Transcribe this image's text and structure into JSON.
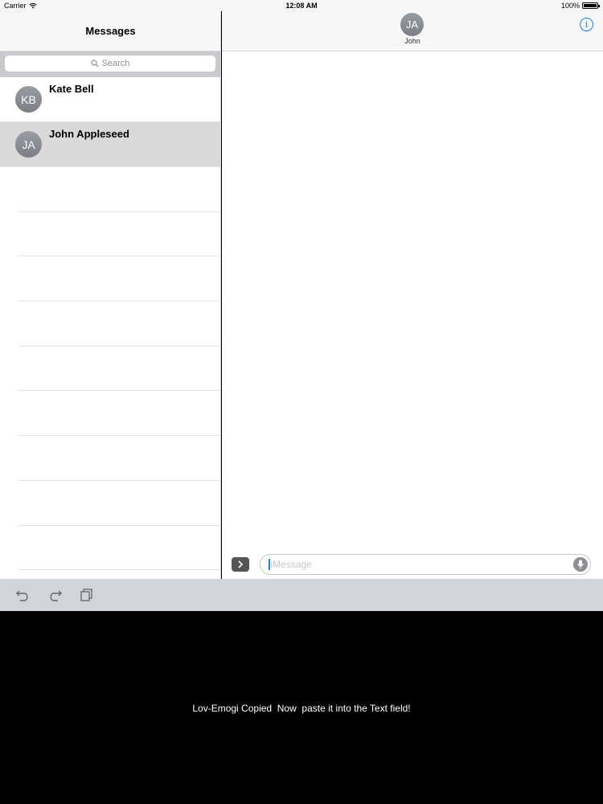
{
  "status_bar": {
    "carrier": "Carrier",
    "time": "12:08 AM",
    "battery": "100%",
    "battery_level": 1.0
  },
  "master": {
    "title": "Messages",
    "search_placeholder": "Search",
    "conversations": [
      {
        "initials": "KB",
        "name": "Kate Bell",
        "selected": false
      },
      {
        "initials": "JA",
        "name": "John Appleseed",
        "selected": true
      }
    ]
  },
  "detail": {
    "contact_initials": "JA",
    "contact_name": "John",
    "info_icon": "info-icon",
    "message_placeholder": "iMessage"
  },
  "keyboard": {
    "toolbar_icons": [
      "undo-icon",
      "redo-icon",
      "clipboard-icon"
    ],
    "message": "Lov-Emogi Copied  Now  paste it into the Text field!"
  },
  "colors": {
    "accent": "#1e7ef5",
    "selected_row": "#d9d9d9",
    "keyboard_background": "#000000",
    "toolbar_background": "#d1d4da"
  }
}
